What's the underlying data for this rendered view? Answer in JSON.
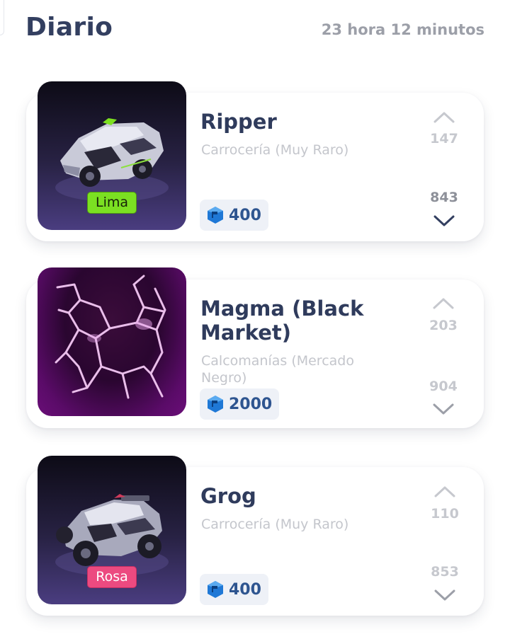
{
  "header": {
    "title": "Diario",
    "timer": "23 hora 12 minutos"
  },
  "items": [
    {
      "name": "Ripper",
      "category": "Carrocería (Muy Raro)",
      "color_tag": "Lima",
      "price": "400",
      "upvotes": "147",
      "downvotes": "843",
      "thumb_icon": "car-icon"
    },
    {
      "name": "Magma (Black Market)",
      "category": "Calcomanías (Mercado Negro)",
      "color_tag": "",
      "price": "2000",
      "upvotes": "203",
      "downvotes": "904",
      "thumb_icon": "magma-decal-icon"
    },
    {
      "name": "Grog",
      "category": "Carrocería (Muy Raro)",
      "color_tag": "Rosa",
      "price": "400",
      "upvotes": "110",
      "downvotes": "853",
      "thumb_icon": "car-icon"
    }
  ],
  "colors": {
    "title": "#333f60",
    "tag_lima": "#7be022",
    "tag_rosa": "#ec4a80",
    "price_text": "#2e5590",
    "credits_gem": "#1f78d6"
  }
}
